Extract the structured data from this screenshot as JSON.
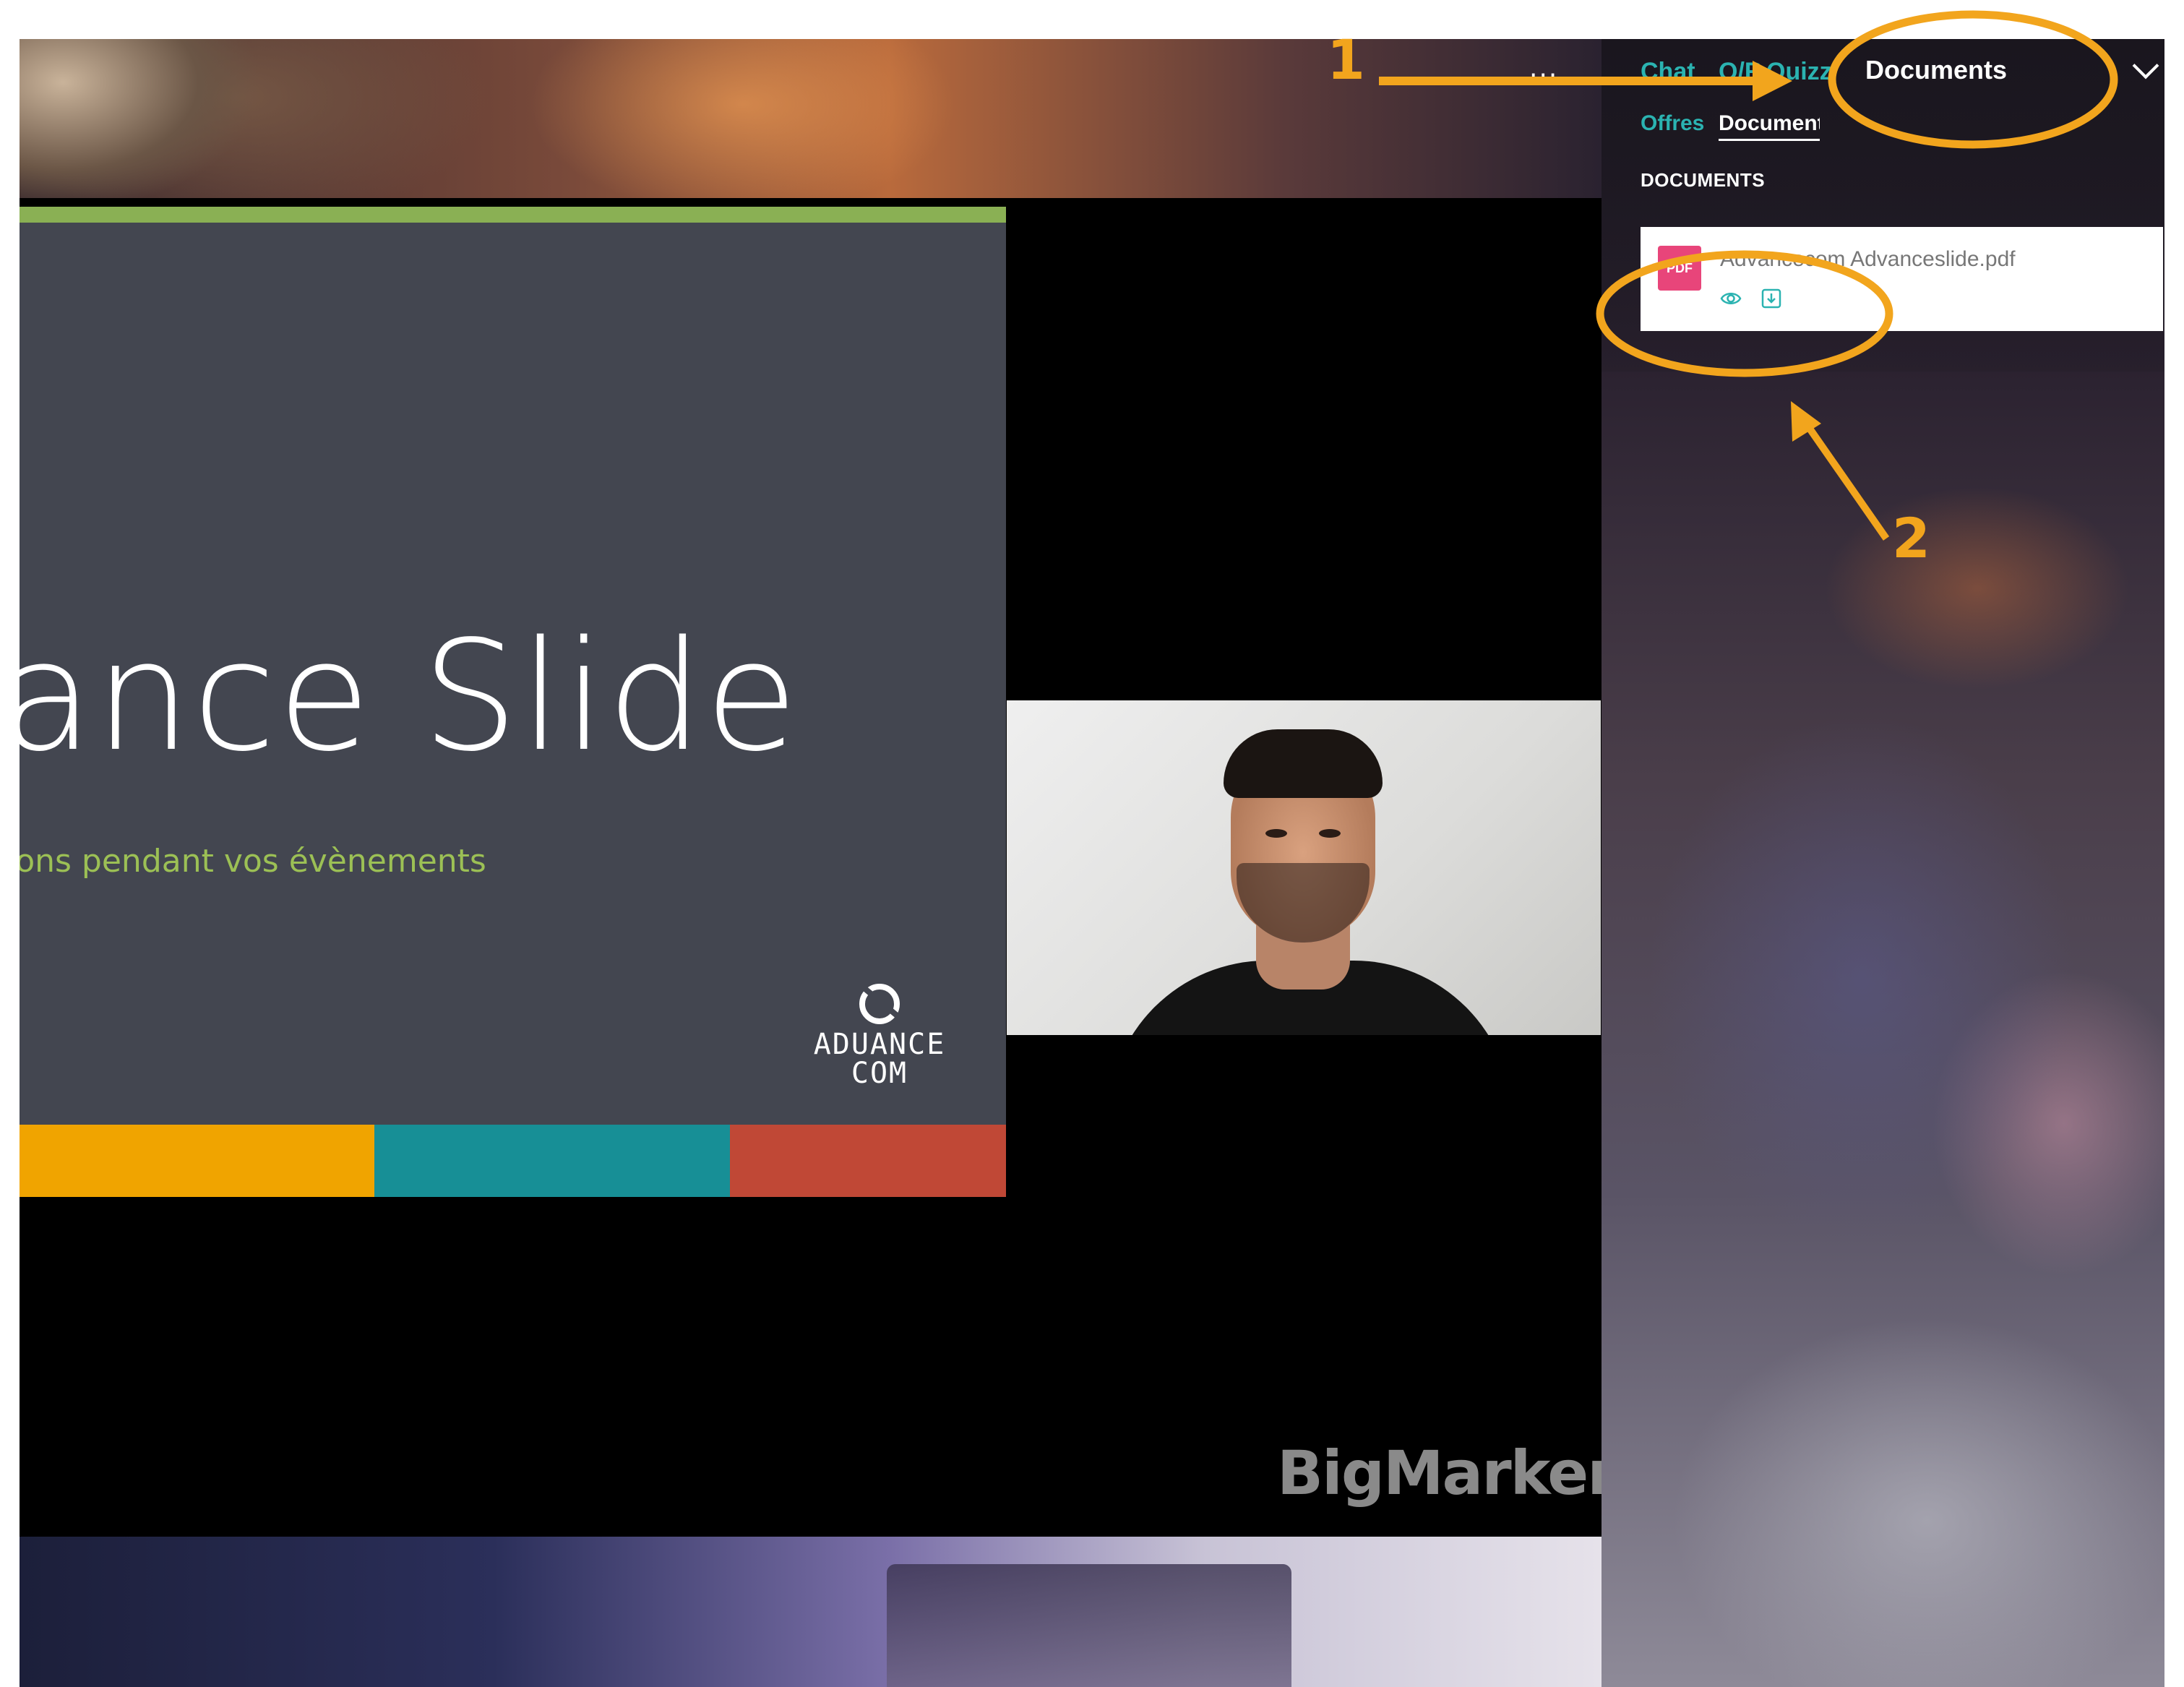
{
  "topbar": {
    "more_label": "...",
    "tabs": [
      {
        "label": "Chat",
        "active": false
      },
      {
        "label": "Q/R",
        "active": false
      },
      {
        "label": "Quizz",
        "active": false
      },
      {
        "label": "Documents",
        "active": true
      }
    ]
  },
  "panel": {
    "subtabs": [
      {
        "label": "Offres",
        "active": false
      },
      {
        "label": "Documents",
        "active": true
      }
    ],
    "section_heading": "DOCUMENTS",
    "documents": [
      {
        "name": "Advancecom Advanceslide.pdf",
        "type_badge": "PDF",
        "actions": [
          "eye-icon",
          "download-icon"
        ]
      }
    ]
  },
  "slide": {
    "title": "Advance Slide",
    "subtitle": "Vos présentations pendant vos évènements",
    "logo_line1": "ADUANCE",
    "logo_line2": "COM",
    "stripe_colors": [
      "#f0a400",
      "#178f96",
      "#c04836"
    ],
    "top_bar_color": "#8ab054"
  },
  "brand": "BigMarker",
  "annotations": {
    "label_1": "1",
    "label_2": "2",
    "color": "#f2a51d"
  },
  "colors": {
    "accent": "#2bb3b1",
    "pdf_badge": "#e8457a"
  }
}
